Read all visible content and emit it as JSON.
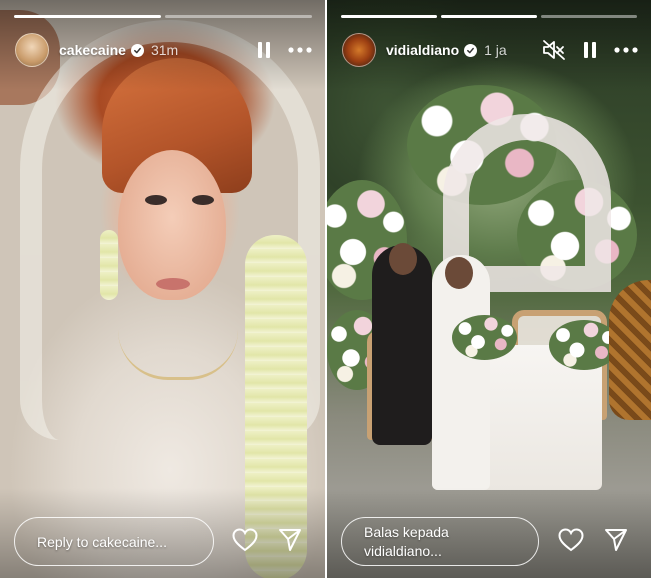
{
  "stories": [
    {
      "username": "cakecaine",
      "verified": true,
      "time": "31m",
      "progress": [
        1.0,
        0.0
      ],
      "reply_placeholder": "Reply to cakecaine...",
      "header_icons": [
        "pause-icon",
        "more-icon"
      ],
      "action_icons": [
        "heart-icon",
        "send-icon"
      ]
    },
    {
      "username": "vidialdiano",
      "verified": true,
      "time": "1 ja",
      "progress": [
        1.0,
        1.0,
        0.0
      ],
      "reply_placeholder": "Balas kepada\nvidialdiano...",
      "header_icons": [
        "mute-icon",
        "pause-icon",
        "more-icon"
      ],
      "action_icons": [
        "heart-icon",
        "send-icon"
      ]
    }
  ],
  "colors": {
    "overlay_text": "#ffffff",
    "progress_track": "rgba(255,255,255,0.45)",
    "progress_fill": "#ffffff",
    "background": "#ffffff"
  }
}
